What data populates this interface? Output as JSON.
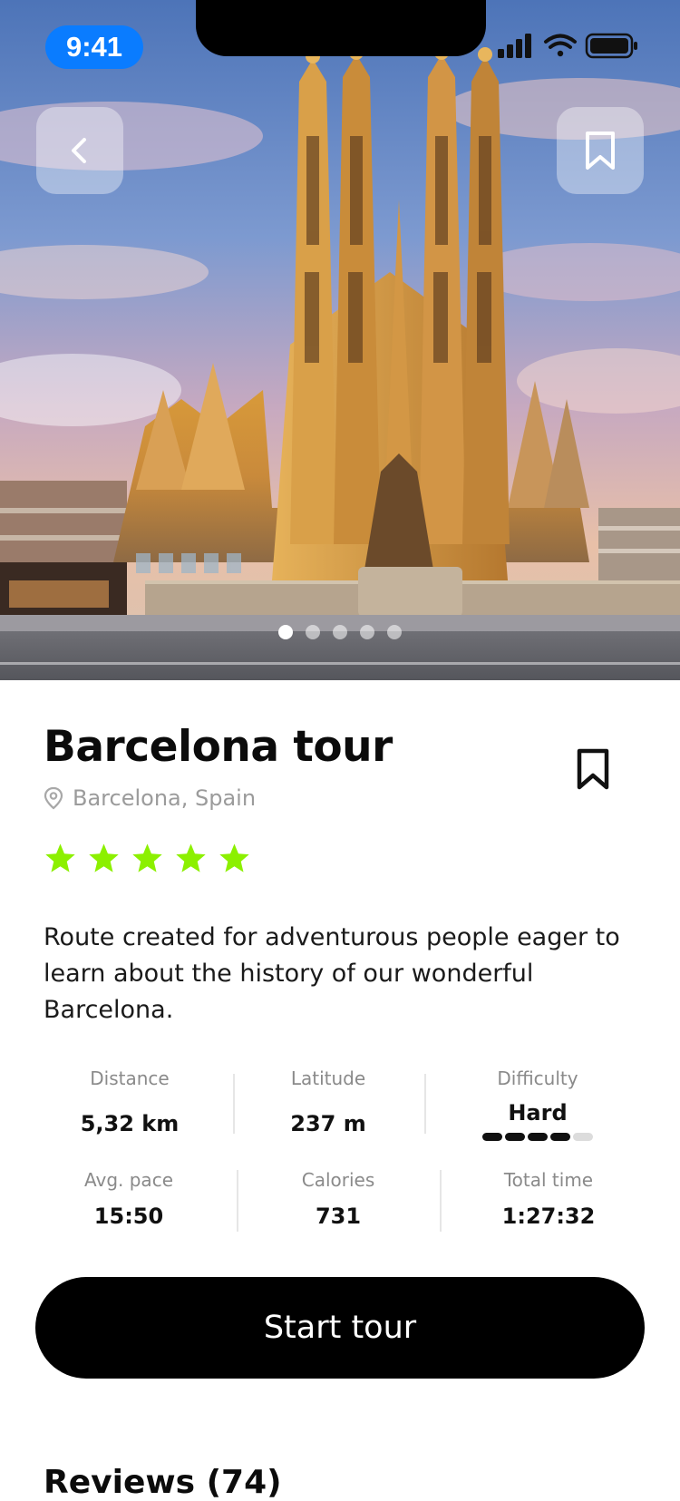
{
  "status_bar": {
    "time": "9:41"
  },
  "hero": {
    "carousel": {
      "count": 5,
      "active_index": 0
    }
  },
  "tour": {
    "title": "Barcelona tour",
    "location": "Barcelona, Spain",
    "rating": 5,
    "rating_max": 5,
    "description": "Route created for adventurous people eager to learn about the history of our wonderful Barcelona."
  },
  "stats": {
    "distance": {
      "label": "Distance",
      "value": "5,32 km"
    },
    "latitude": {
      "label": "Latitude",
      "value": "237 m"
    },
    "difficulty": {
      "label": "Difficulty",
      "value": "Hard",
      "level": 4,
      "level_max": 5
    },
    "avg_pace": {
      "label": "Avg. pace",
      "value": "15:50"
    },
    "calories": {
      "label": "Calories",
      "value": "731"
    },
    "total_time": {
      "label": "Total time",
      "value": "1:27:32"
    }
  },
  "cta": {
    "label": "Start tour"
  },
  "reviews": {
    "title": "Reviews (74)"
  },
  "colors": {
    "star": "#8cf000",
    "time_pill": "#0a7cff",
    "cta_background": "#000000"
  },
  "icons": {
    "back": "chevron-left-icon",
    "bookmark": "bookmark-icon",
    "location": "map-pin-icon",
    "signal": "cellular-signal-icon",
    "wifi": "wifi-icon",
    "battery": "battery-icon",
    "star": "star-icon"
  }
}
